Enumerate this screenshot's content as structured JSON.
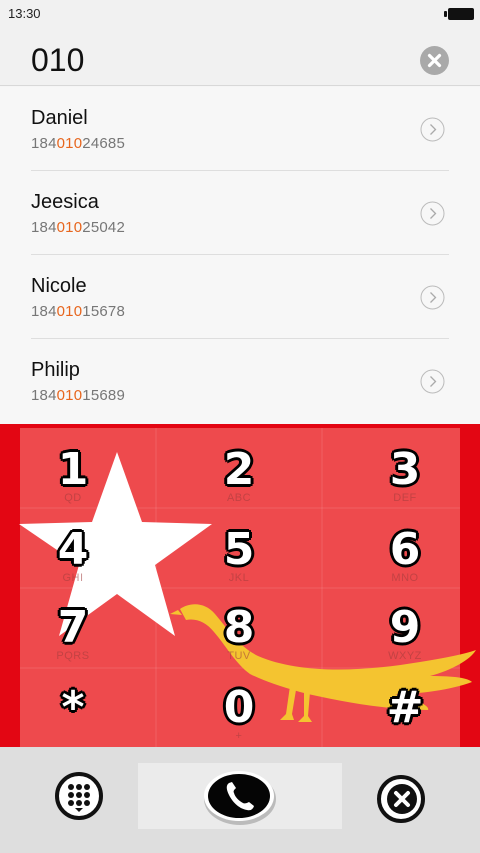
{
  "status_bar": {
    "time": "13:30"
  },
  "search": {
    "query": "010"
  },
  "contacts": [
    {
      "name": "Daniel",
      "number_prefix": "184",
      "number_match": "010",
      "number_suffix": "24685"
    },
    {
      "name": "Jeesica",
      "number_prefix": "184",
      "number_match": "010",
      "number_suffix": "25042"
    },
    {
      "name": "Nicole",
      "number_prefix": "184",
      "number_match": "010",
      "number_suffix": "15678"
    },
    {
      "name": "Philip",
      "number_prefix": "184",
      "number_match": "010",
      "number_suffix": "15689"
    }
  ],
  "keypad": {
    "keys": [
      {
        "digit": "1",
        "letters": "QD"
      },
      {
        "digit": "2",
        "letters": "ABC"
      },
      {
        "digit": "3",
        "letters": "DEF"
      },
      {
        "digit": "4",
        "letters": "GHI"
      },
      {
        "digit": "5",
        "letters": "JKL"
      },
      {
        "digit": "6",
        "letters": "MNO"
      },
      {
        "digit": "7",
        "letters": "PQRS"
      },
      {
        "digit": "8",
        "letters": "TUV"
      },
      {
        "digit": "9",
        "letters": "WXYZ"
      },
      {
        "digit": "*",
        "letters": ""
      },
      {
        "digit": "0",
        "letters": "+"
      },
      {
        "digit": "#",
        "letters": ""
      }
    ]
  },
  "colors": {
    "highlight": "#e7661e",
    "keypad_red": "#e30613",
    "bird_yellow": "#f4c430"
  },
  "icons": {
    "clear": "close-circle-icon",
    "chevron": "chevron-right-icon",
    "keypad_toggle": "dialpad-icon",
    "call": "phone-icon",
    "backspace": "backspace-icon"
  }
}
